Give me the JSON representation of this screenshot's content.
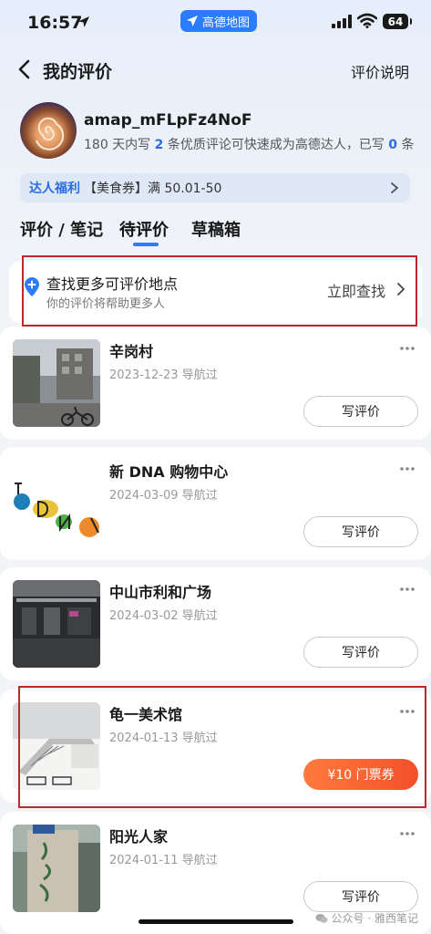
{
  "status_bar": {
    "time": "16:57",
    "app_pill": "高德地图",
    "battery": "64",
    "icons": [
      "location-arrow-icon",
      "signal-icon",
      "wifi-icon",
      "battery-icon"
    ]
  },
  "nav": {
    "title": "我的评价",
    "help": "评价说明",
    "icon": "back-icon"
  },
  "profile": {
    "username": "amap_mFLpFz4NoF",
    "desc_pre": "180 天内写 ",
    "desc_count": "2",
    "desc_mid": " 条优质评论可快速成为高德达人，已写 ",
    "desc_done": "0",
    "desc_post": " 条"
  },
  "banner": {
    "tag": "达人福利",
    "text": "【美食券】满 50.01-50"
  },
  "tabs": [
    {
      "label": "评价 / 笔记",
      "active": false
    },
    {
      "label": "待评价",
      "active": true
    },
    {
      "label": "草稿箱",
      "active": false
    }
  ],
  "find_card": {
    "title": "查找更多可评价地点",
    "subtitle": "你的评价将帮助更多人",
    "action": "立即查找"
  },
  "places": [
    {
      "name": "辛岗村",
      "date": "2023-12-23 导航过",
      "button": "写评价"
    },
    {
      "name": "新 DNA 购物中心",
      "date": "2024-03-09 导航过",
      "button": "写评价"
    },
    {
      "name": "中山市利和广场",
      "date": "2024-03-02 导航过",
      "button": "写评价"
    },
    {
      "name": "龟一美术馆",
      "date": "2024-01-13 导航过",
      "button": "¥10 门票券"
    },
    {
      "name": "阳光人家",
      "date": "2024-01-11 导航过",
      "button": "写评价"
    }
  ],
  "watermark": "公众号 · 雅西笔记",
  "colors": {
    "accent": "#2b7cff",
    "ticket_start": "#ff7a3d",
    "ticket_end": "#f4502a",
    "highlight_box": "#c0272d"
  }
}
